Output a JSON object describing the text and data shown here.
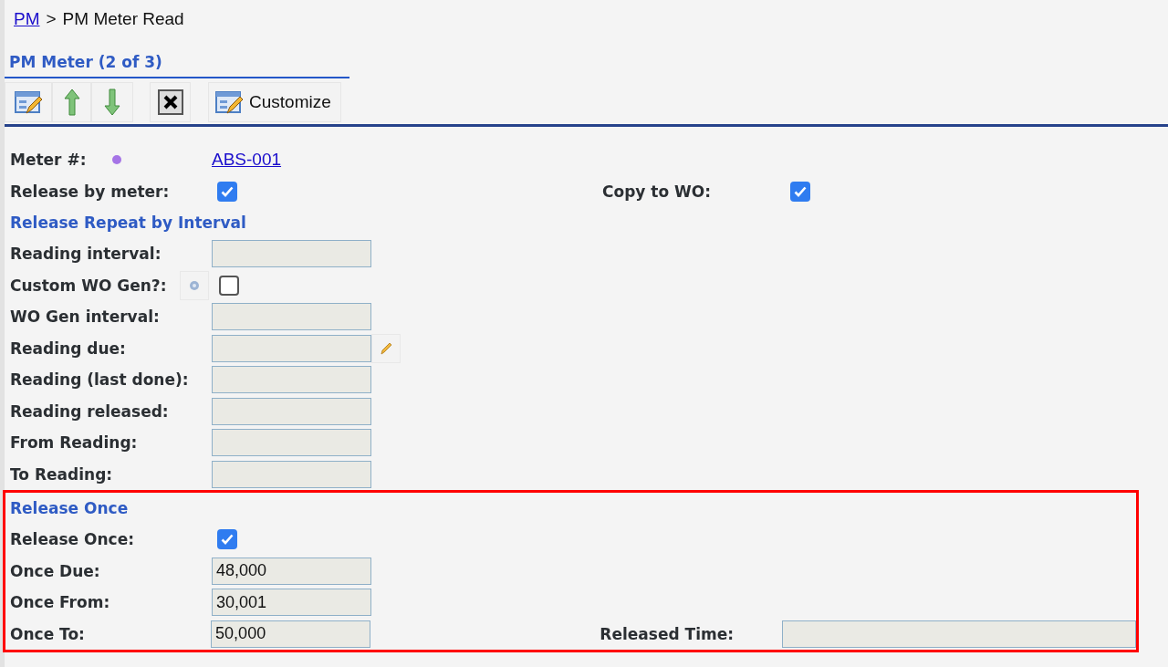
{
  "breadcrumb": {
    "link": "PM",
    "separator": ">",
    "current": "PM Meter Read"
  },
  "panel_title": "PM Meter (2 of 3)",
  "toolbar": {
    "customize_label": "Customize"
  },
  "sections": [
    {
      "highlighted": false,
      "rows": [
        {
          "kind": "link",
          "label": "Meter #:",
          "value": "ABS-001"
        },
        {
          "kind": "checkbox",
          "label": "Release by meter:",
          "checked": true,
          "right": {
            "kind": "checkbox",
            "label": "Copy to WO:",
            "checked": true
          }
        }
      ]
    },
    {
      "heading": "Release Repeat by Interval",
      "highlighted": false,
      "rows": [
        {
          "kind": "field",
          "label": "Reading interval:"
        },
        {
          "kind": "checkbox",
          "label": "Custom WO Gen?:",
          "checked": false,
          "help_button": true
        },
        {
          "kind": "field",
          "label": "WO Gen interval:"
        },
        {
          "kind": "field",
          "label": "Reading due:",
          "edit_button": true
        },
        {
          "kind": "field",
          "label": "Reading (last done):"
        },
        {
          "kind": "field",
          "label": "Reading released:"
        },
        {
          "kind": "field",
          "label": "From Reading:"
        },
        {
          "kind": "field",
          "label": "To Reading:"
        }
      ]
    },
    {
      "heading": "Release Once",
      "highlighted": true,
      "rows": [
        {
          "kind": "checkbox",
          "label": "Release Once:",
          "checked": true
        },
        {
          "kind": "field",
          "label": "Once Due:",
          "value": "48,000"
        },
        {
          "kind": "field",
          "label": "Once From:",
          "value": "30,001"
        },
        {
          "kind": "field",
          "label": "Once To:",
          "value": "50,000",
          "right": {
            "kind": "field",
            "label": "Released Time:"
          }
        }
      ]
    }
  ]
}
